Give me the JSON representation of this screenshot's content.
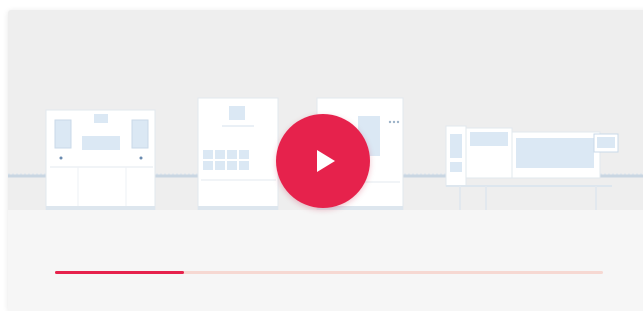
{
  "video": {
    "play_icon": "play-icon",
    "progress_fraction": 0.235,
    "colors": {
      "accent": "#e6224c",
      "progress_track": "#f6d8d2",
      "background": "#f6f6f6",
      "machine_fill": "#ffffff",
      "machine_stroke": "#dde6ee",
      "machine_detail": "#d4e4f1"
    }
  }
}
